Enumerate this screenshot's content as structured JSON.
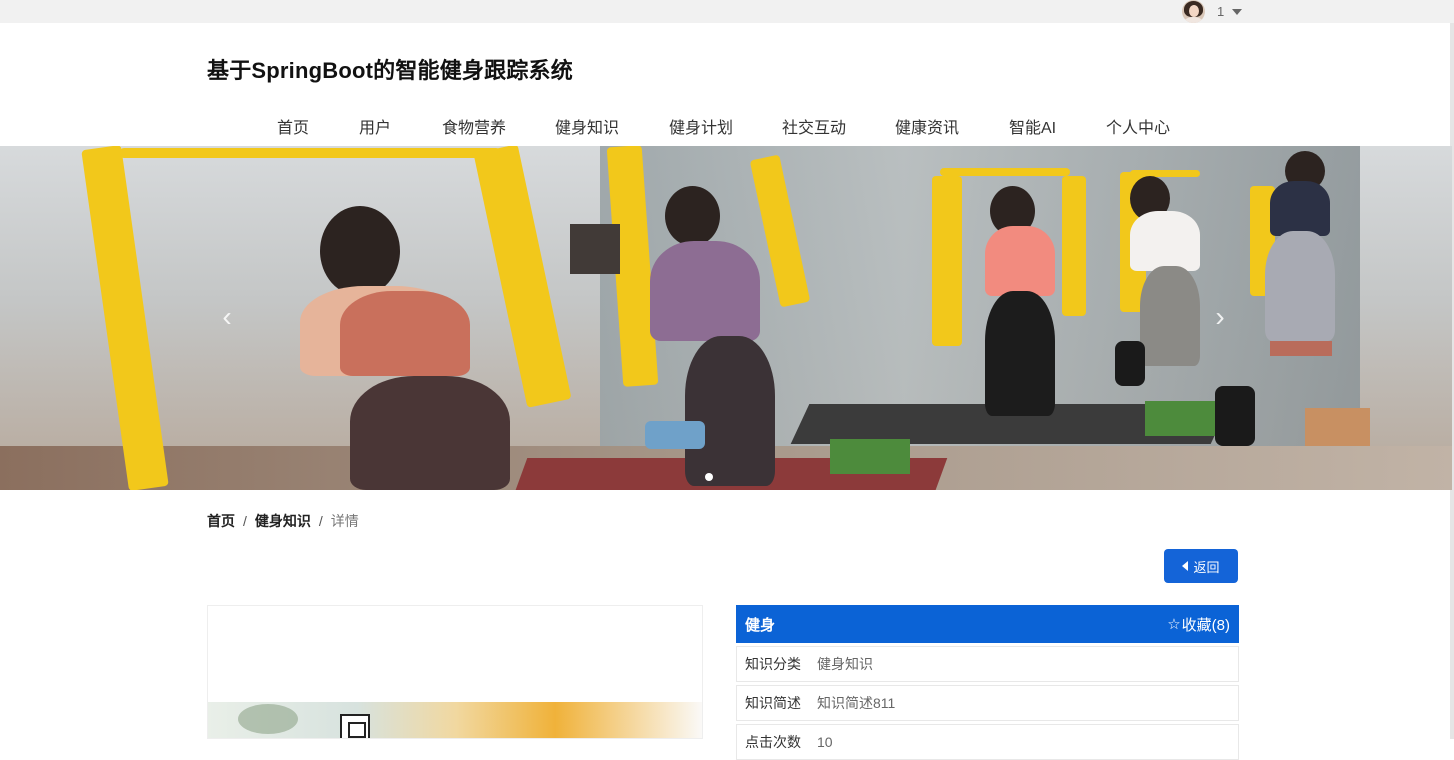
{
  "topbar": {
    "user_name": "1",
    "avatar_icon": "user-avatar",
    "dropdown_icon": "caret-down-icon"
  },
  "site": {
    "title": "基于SpringBoot的智能健身跟踪系统"
  },
  "nav": {
    "items": [
      {
        "label": "首页"
      },
      {
        "label": "用户"
      },
      {
        "label": "食物营养"
      },
      {
        "label": "健身知识"
      },
      {
        "label": "健身计划"
      },
      {
        "label": "社交互动"
      },
      {
        "label": "健康资讯"
      },
      {
        "label": "智能AI"
      },
      {
        "label": "个人中心"
      }
    ]
  },
  "carousel": {
    "prev_icon": "chevron-left-icon",
    "next_icon": "chevron-right-icon",
    "active_slide": 1,
    "slide_count": 1
  },
  "breadcrumb": {
    "home": "首页",
    "section": "健身知识",
    "current": "详情",
    "separator": "/"
  },
  "actions": {
    "back_label": "返回"
  },
  "detail": {
    "title": "健身",
    "favorite": {
      "icon": "star-outline-icon",
      "label": "收藏(8)"
    },
    "rows": [
      {
        "label": "知识分类",
        "value": "健身知识"
      },
      {
        "label": "知识简述",
        "value": "知识简述811"
      },
      {
        "label": "点击次数",
        "value": "10"
      }
    ]
  },
  "colors": {
    "primary": "#0b63d6",
    "topbar": "#f1f1f1",
    "band": "#f2c81b"
  }
}
